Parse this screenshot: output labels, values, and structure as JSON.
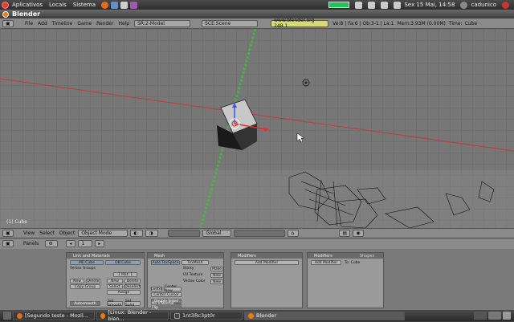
{
  "top_panel": {
    "menus": [
      "Aplicativos",
      "Locais",
      "Sistema"
    ],
    "datetime": "Sex 15 Mai, 14:58",
    "user": "cadunico"
  },
  "window": {
    "title": "Blender"
  },
  "info_header": {
    "menus": [
      "File",
      "Add",
      "Timeline",
      "Game",
      "Render",
      "Help"
    ],
    "screen": "SR:2-Model",
    "scene": "SCE:Scene",
    "url": "www.blender.org 248.1",
    "stats": "Ve:8 | Fa:6 | Ob:3-1 | La:1",
    "mem": "Mem:3.93M (0.00M)",
    "time": "Time:",
    "obj": "Cube"
  },
  "viewport": {
    "object_label": "(1) Cube"
  },
  "view_header": {
    "menus": [
      "View",
      "Select",
      "Object"
    ],
    "mode": "Object Mode",
    "pivot": "Global"
  },
  "buttons_header": {
    "label": "Panels",
    "frame": "1"
  },
  "panels": {
    "link_materials": {
      "title": "Link and Materials",
      "me": "ME:Cube",
      "ob": "OB:Cube",
      "vgroup": "Vertex Groups",
      "mat": "1 Mat: 1",
      "buttons": [
        "New",
        "Delete",
        "Copy Group",
        "New",
        "Delete",
        "Select",
        "Deselect",
        "Assign",
        "Autosmooth",
        "Set Smooth",
        "Set Solid"
      ]
    },
    "mesh": {
      "title": "Mesh",
      "buttons": [
        "Auto TexSpace",
        "TexMesh",
        "Sticky",
        "Make",
        "UV Texture",
        "New",
        "Vertex Color",
        "New",
        "Double Sided",
        "No V.Normal Flip",
        "Center",
        "Center New",
        "Center Cursor"
      ]
    },
    "modifiers": {
      "title": "Modifiers",
      "button": "Add Modifier"
    },
    "shapes": {
      "tabs": [
        "Modifiers",
        "Shapes"
      ],
      "add": "Add Modifier",
      "to": "To: Cube"
    }
  },
  "taskbar": {
    "tasks": [
      "[Segundo teste - Mozil...",
      "[Linux: Blender - blen...",
      "1nt3Rc3pt0r",
      "Blender"
    ]
  },
  "colors": {
    "accent": "#dd4814",
    "blender": "#e87d0d",
    "grid_x": "#c23c3c",
    "grid_y": "#3cbf3c"
  }
}
